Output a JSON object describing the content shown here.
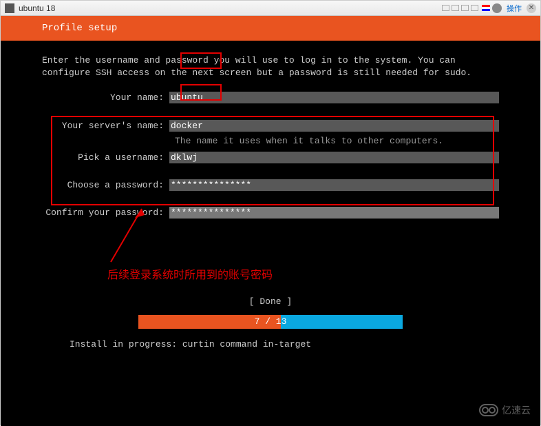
{
  "window": {
    "title": "ubuntu 18",
    "action_label": "操作"
  },
  "header": {
    "title": "Profile setup"
  },
  "description": "Enter the username and password you will use to log in to the system. You can configure SSH access on the next screen but a password is still needed for sudo.",
  "form": {
    "name": {
      "label": "Your name:",
      "value": "ubuntu"
    },
    "server": {
      "label": "Your server's name:",
      "value": "docker",
      "help": "The name it uses when it talks to other computers."
    },
    "username": {
      "label": "Pick a username:",
      "value": "dklwj"
    },
    "password": {
      "label": "Choose a password:",
      "value": "***************"
    },
    "confirm": {
      "label": "Confirm your password:",
      "value": "***************"
    }
  },
  "annotation": "后续登录系统时所用到的账号密码",
  "done_button": "[ Done       ]",
  "progress": {
    "current": 7,
    "total": 13,
    "text": "7 / 13"
  },
  "status": "Install in progress: curtin command in-target",
  "watermark": "亿速云"
}
